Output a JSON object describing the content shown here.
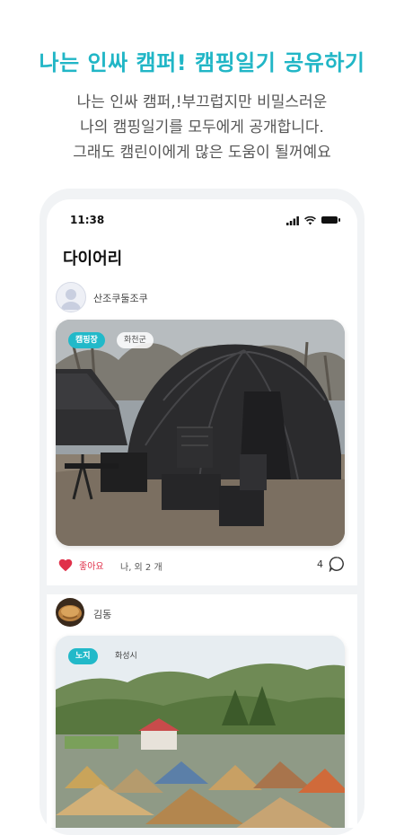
{
  "promo": {
    "title": "나는 인싸 캠퍼! 캠핑일기 공유하기",
    "subtitle_lines": [
      "나는 인싸 캠퍼,!부끄럽지만 비밀스러운",
      "나의 캠핑일기를 모두에게 공개합니다.",
      "그래도 캠린이에게 많은 도움이 될꺼예요"
    ]
  },
  "status_bar": {
    "time": "11:38"
  },
  "screen": {
    "title": "다이어리"
  },
  "posts": [
    {
      "author": "산조쿠둘조쿠",
      "tags": [
        "캠핑장",
        "화천군"
      ],
      "like_label": "좋아요",
      "likers": "나, 외 2 개",
      "comment_count": "4"
    },
    {
      "author": "김동",
      "tags": [
        "노지",
        "화성시"
      ]
    }
  ],
  "colors": {
    "accent": "#21b6c6",
    "like": "#e0314a"
  }
}
